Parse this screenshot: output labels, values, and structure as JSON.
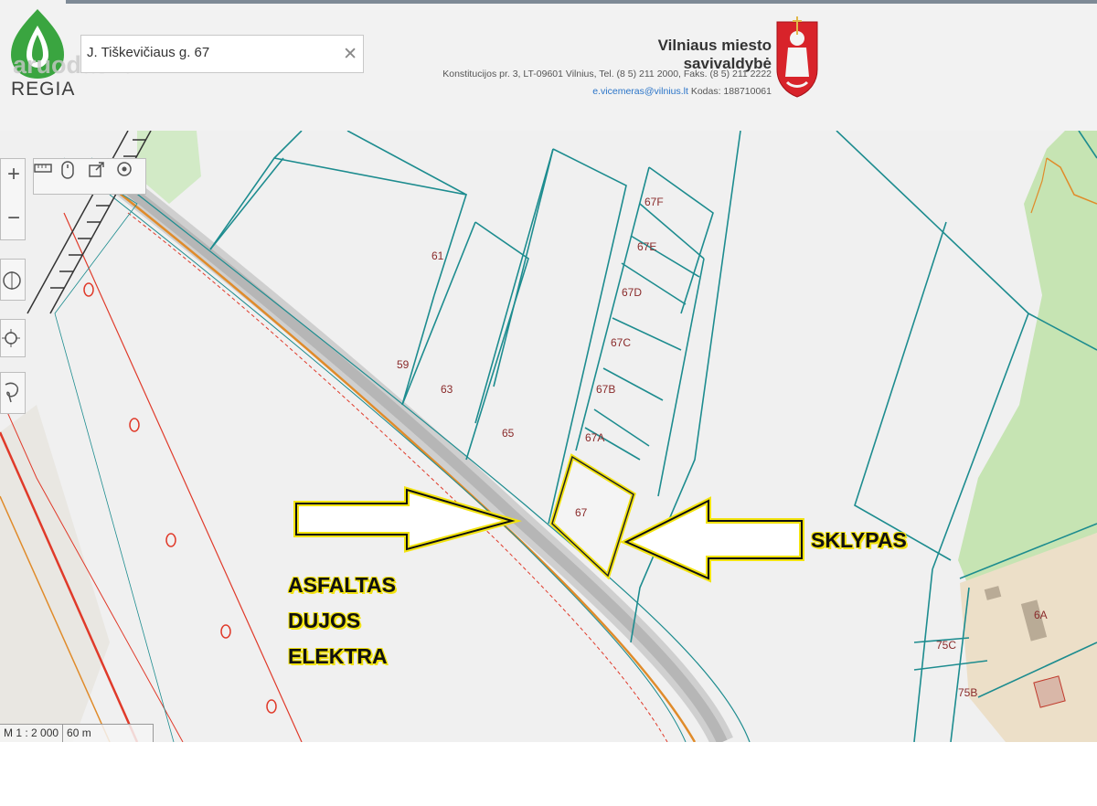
{
  "header": {
    "brand": "REGIA",
    "watermark": "aruodas.lt",
    "search_value": "J. Tiškevičiaus g. 67",
    "clear_icon": "close-icon",
    "municipality_name": "Vilniaus miesto savivaldybė",
    "address_line": "Konstitucijos pr. 3, LT-09601 Vilnius, Tel. (8 5) 211 2000, Faks. (8 5) 211 2222",
    "email": "e.vicemeras@vilnius.lt",
    "code": "Kodas: 188710061"
  },
  "toolbar": {
    "zoom_in": "+",
    "zoom_out": "−",
    "icons": [
      "measure-icon",
      "mouse-icon",
      "share-icon",
      "target-icon",
      "compass-icon",
      "locate-icon",
      "lasso-icon"
    ]
  },
  "map": {
    "parcels": [
      "61",
      "59",
      "63",
      "65",
      "67F",
      "67E",
      "67D",
      "67C",
      "67B",
      "67A",
      "67",
      "75C",
      "75B",
      "6A"
    ],
    "annotations": {
      "left": [
        "ASFALTAS",
        "DUJOS",
        "ELEKTRA"
      ],
      "right": "SKLYPAS"
    },
    "scale_ratio": "M 1 : 2 000",
    "scale_bar": "60 m"
  },
  "colors": {
    "parcel_line": "#1d8c8f",
    "road": "#b8b8b8",
    "gas_line": "#e08b2a",
    "power_line": "#e03a2a",
    "forest": "#c9e6b8",
    "highlight": "#f2e30f"
  }
}
